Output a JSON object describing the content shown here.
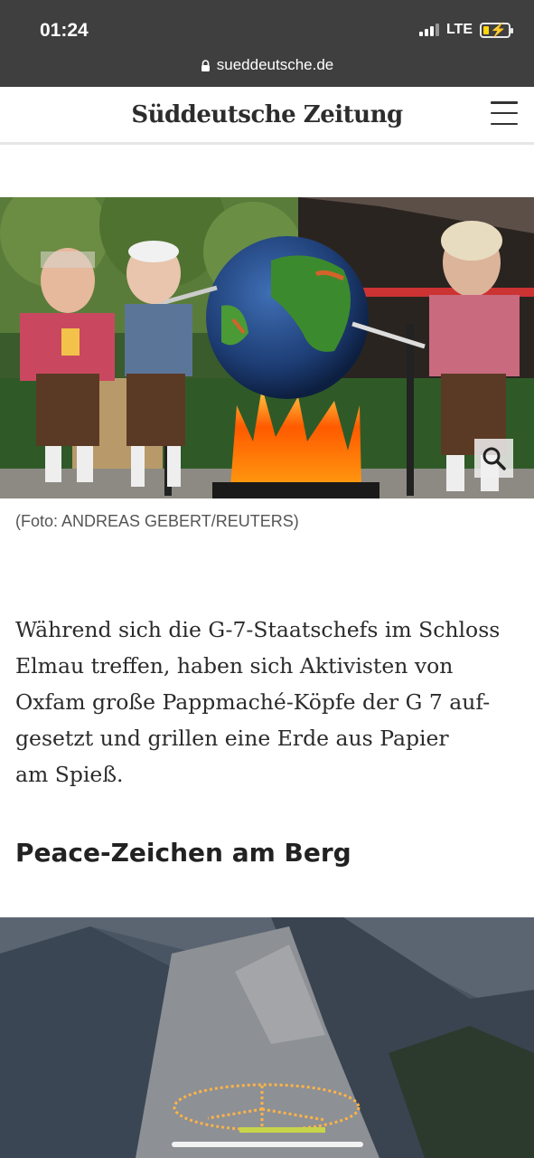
{
  "status_bar": {
    "time": "01:24",
    "network": "LTE",
    "icons": [
      "signal-icon",
      "battery-charging-icon"
    ]
  },
  "browser": {
    "url": "sueddeutsche.de",
    "lock_icon": "lock-icon"
  },
  "header": {
    "logo_text": "Süddeutsche Zeitung",
    "menu_icon": "hamburger-menu-icon"
  },
  "article": {
    "image1_caption": "(Foto: ANDREAS GEBERT/REUTERS)",
    "zoom_icon": "search-zoom-icon",
    "paragraph_lines": [
      "Während sich die G-7-Staatschefs im Schloss",
      "Elmau treffen, haben sich Aktivisten von",
      "Oxfam große Pappmaché-Köpfe der G 7 auf-",
      "gesetzt und grillen eine Erde aus Papier",
      "am Spieß."
    ],
    "subheading": "Peace-Zeichen am Berg"
  },
  "colors": {
    "chrome_bg": "#3f3f3f",
    "battery_charge": "#ffd60a",
    "body_text": "#2b2b2b"
  }
}
